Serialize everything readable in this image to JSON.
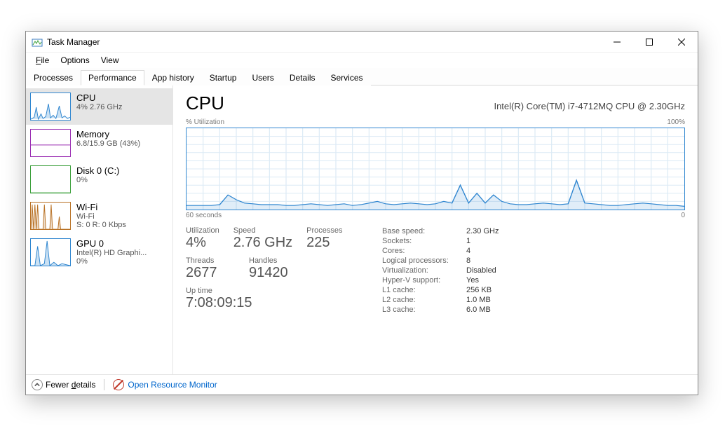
{
  "window": {
    "title": "Task Manager"
  },
  "menu": {
    "file": "File",
    "options": "Options",
    "view": "View"
  },
  "tabs": {
    "processes": "Processes",
    "performance": "Performance",
    "apphistory": "App history",
    "startup": "Startup",
    "users": "Users",
    "details": "Details",
    "services": "Services"
  },
  "sidebar": {
    "cpu": {
      "title": "CPU",
      "sub1": "4%  2.76 GHz",
      "color": "#2f86d0"
    },
    "mem": {
      "title": "Memory",
      "sub1": "6.8/15.9 GB (43%)",
      "color": "#9b2fb3"
    },
    "disk": {
      "title": "Disk 0 (C:)",
      "sub1": "0%",
      "color": "#3da03c"
    },
    "wifi": {
      "title": "Wi-Fi",
      "sub1": "Wi-Fi",
      "sub2": "S: 0  R: 0 Kbps",
      "color": "#b97226"
    },
    "gpu": {
      "title": "GPU 0",
      "sub1": "Intel(R) HD Graphi...",
      "sub2": "0%",
      "color": "#2f86d0"
    }
  },
  "main": {
    "title": "CPU",
    "model": "Intel(R) Core(TM) i7-4712MQ CPU @ 2.30GHz",
    "chart_top_left": "% Utilization",
    "chart_top_right": "100%",
    "chart_bot_left": "60 seconds",
    "chart_bot_right": "0",
    "utilization_label": "Utilization",
    "utilization_val": "4%",
    "speed_label": "Speed",
    "speed_val": "2.76 GHz",
    "processes_label": "Processes",
    "processes_val": "225",
    "threads_label": "Threads",
    "threads_val": "2677",
    "handles_label": "Handles",
    "handles_val": "91420",
    "uptime_label": "Up time",
    "uptime_val": "7:08:09:15",
    "kv": [
      {
        "k": "Base speed:",
        "v": "2.30 GHz"
      },
      {
        "k": "Sockets:",
        "v": "1"
      },
      {
        "k": "Cores:",
        "v": "4"
      },
      {
        "k": "Logical processors:",
        "v": "8"
      },
      {
        "k": "Virtualization:",
        "v": "Disabled"
      },
      {
        "k": "Hyper-V support:",
        "v": "Yes"
      },
      {
        "k": "L1 cache:",
        "v": "256 KB"
      },
      {
        "k": "L2 cache:",
        "v": "1.0 MB"
      },
      {
        "k": "L3 cache:",
        "v": "6.0 MB"
      }
    ]
  },
  "bottom": {
    "fewer": "Fewer details",
    "rmon": "Open Resource Monitor"
  },
  "chart_data": {
    "type": "line",
    "title": "CPU % Utilization",
    "xlabel": "seconds ago",
    "ylabel": "% Utilization",
    "ylim": [
      0,
      100
    ],
    "x_range_seconds": 60,
    "x": [
      60,
      59,
      58,
      57,
      56,
      55,
      54,
      53,
      52,
      51,
      50,
      49,
      48,
      47,
      46,
      45,
      44,
      43,
      42,
      41,
      40,
      39,
      38,
      37,
      36,
      35,
      34,
      33,
      32,
      31,
      30,
      29,
      28,
      27,
      26,
      25,
      24,
      23,
      22,
      21,
      20,
      19,
      18,
      17,
      16,
      15,
      14,
      13,
      12,
      11,
      10,
      9,
      8,
      7,
      6,
      5,
      4,
      3,
      2,
      1,
      0
    ],
    "values": [
      5,
      5,
      5,
      5,
      6,
      18,
      12,
      8,
      7,
      6,
      6,
      6,
      5,
      5,
      6,
      7,
      6,
      5,
      6,
      7,
      5,
      6,
      8,
      10,
      7,
      6,
      7,
      8,
      7,
      6,
      7,
      10,
      8,
      30,
      8,
      20,
      8,
      18,
      10,
      7,
      6,
      6,
      7,
      8,
      7,
      6,
      7,
      36,
      8,
      7,
      6,
      5,
      5,
      6,
      7,
      8,
      7,
      6,
      5,
      5,
      4
    ]
  }
}
